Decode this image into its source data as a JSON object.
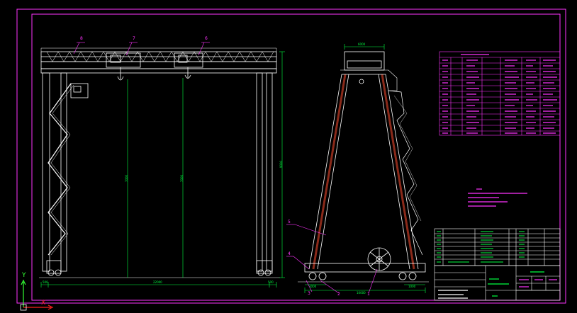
{
  "colors": {
    "background": "#000000",
    "frame": "#ff33ff",
    "structure": "#ffffff",
    "dimension": "#00ff40",
    "callout": "#ff33ff",
    "ucs_x": "#ff2020",
    "ucs_y": "#33ff33"
  },
  "front_view": {
    "callouts": [
      "8",
      "7",
      "6"
    ],
    "dims": {
      "overall_height": "9000",
      "lift_height_1": "7000",
      "lift_height_2": "7000",
      "span": "22000",
      "left_overhang": "500",
      "right_overhang": "500"
    }
  },
  "side_view": {
    "callouts": [
      "5",
      "4",
      "3",
      "2",
      "1"
    ],
    "dims": {
      "top_width": "6000",
      "base_width": "10000",
      "left_base": "1000",
      "right_base": "1000"
    }
  },
  "ucs": {
    "x_label": "X",
    "y_label": "Y"
  }
}
